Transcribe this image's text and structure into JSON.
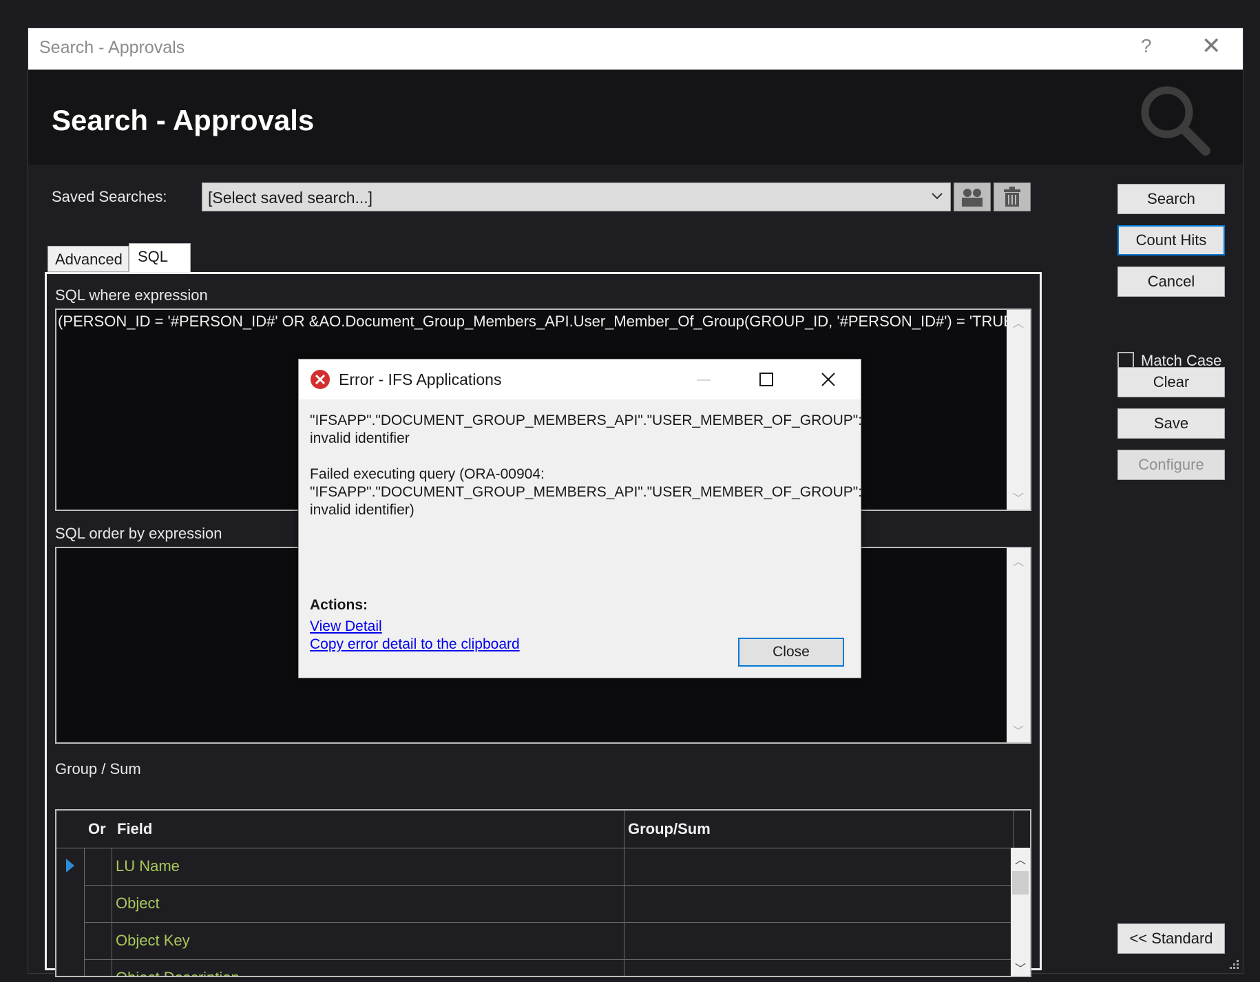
{
  "window": {
    "title": "Search - Approvals",
    "help_label": "?",
    "close_label": "✕"
  },
  "header": {
    "title": "Search - Approvals"
  },
  "saved_searches": {
    "label": "Saved Searches:",
    "value": "[Select saved search...]"
  },
  "buttons": {
    "search": "Search",
    "count_hits": "Count Hits",
    "cancel": "Cancel",
    "match_case": "Match Case",
    "clear": "Clear",
    "save": "Save",
    "configure": "Configure",
    "standard": "<< Standard"
  },
  "tabs": [
    {
      "label": "Advanced"
    },
    {
      "label": "SQL"
    }
  ],
  "sql": {
    "where_label": "SQL where expression",
    "where_value": "(PERSON_ID = '#PERSON_ID#' OR &AO.Document_Group_Members_API.User_Member_Of_Group(GROUP_ID, '#PERSON_ID#') = 'TRUE')",
    "orderby_label": "SQL order by expression",
    "orderby_value": ""
  },
  "group_sum": {
    "label": "Group / Sum",
    "columns": {
      "or": "Or",
      "field": "Field",
      "group_sum": "Group/Sum"
    },
    "rows": [
      {
        "field": "LU Name"
      },
      {
        "field": "Object"
      },
      {
        "field": "Object Key"
      },
      {
        "field": "Object Description"
      }
    ]
  },
  "dialog": {
    "title": "Error - IFS Applications",
    "message_line1": "\"IFSAPP\".\"DOCUMENT_GROUP_MEMBERS_API\".\"USER_MEMBER_OF_GROUP\":",
    "message_line2": "invalid identifier",
    "message_line3": "Failed executing query (ORA-00904:",
    "message_line4": "\"IFSAPP\".\"DOCUMENT_GROUP_MEMBERS_API\".\"USER_MEMBER_OF_GROUP\":",
    "message_line5": "invalid identifier)",
    "actions_label": "Actions:",
    "view_detail": "View Detail",
    "copy_detail": "Copy error detail to the clipboard",
    "close_button": "Close"
  },
  "colors": {
    "accent": "#0078d7",
    "grid_text": "#a9c85a",
    "error_red": "#d32f2f"
  }
}
